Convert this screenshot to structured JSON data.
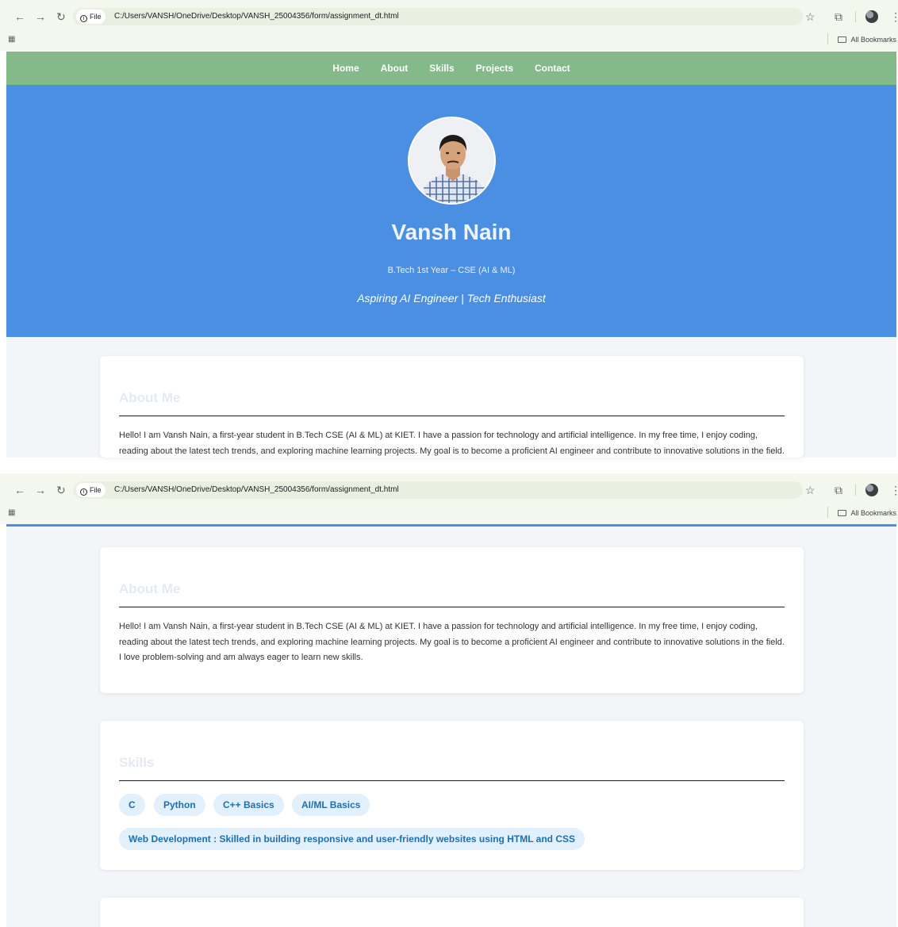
{
  "browser": {
    "chip_label": "File",
    "url": "C:/Users/VANSH/OneDrive/Desktop/VANSH_25004356/form/assignment_dt.html",
    "bookmarks_label": "All Bookmarks"
  },
  "nav": {
    "items": [
      "Home",
      "About",
      "Skills",
      "Projects",
      "Contact"
    ]
  },
  "hero": {
    "name": "Vansh Nain",
    "degree": "B.Tech 1st Year – CSE (AI & ML)",
    "tagline": "Aspiring AI Engineer | Tech Enthusiast"
  },
  "about": {
    "heading": "About Me",
    "text": "Hello! I am Vansh Nain, a first-year student in B.Tech CSE (AI & ML) at KIET. I have a passion for technology and artificial intelligence. In my free time, I enjoy coding, reading about the latest tech trends, and exploring machine learning projects. My goal is to become a proficient AI engineer and contribute to innovative solutions in the field. I love problem-solving and am always eager to learn new skills."
  },
  "skills": {
    "heading": "Skills",
    "items": [
      "C",
      "Python",
      "C++ Basics",
      "AI/ML Basics",
      "Web Development : Skilled in building responsive and user-friendly websites using HTML and CSS"
    ]
  },
  "colors": {
    "nav_bg": "#84b98a",
    "hero_bg": "#4a8fe2",
    "pill_bg": "#e1f0fb",
    "pill_text": "#1f6fb0"
  }
}
